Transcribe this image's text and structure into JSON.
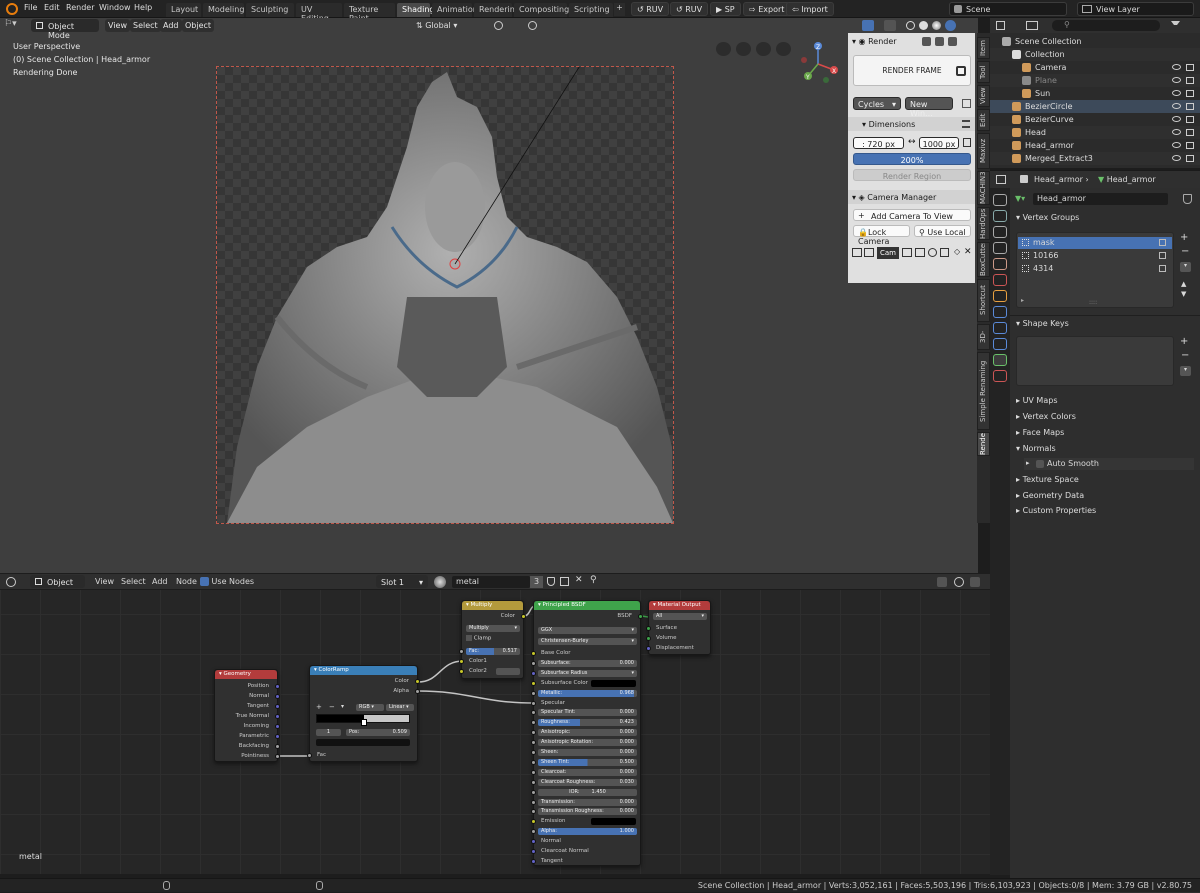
{
  "menu": [
    "File",
    "Edit",
    "Render",
    "Window",
    "Help"
  ],
  "workspaces": [
    "Layout",
    "Modeling",
    "Sculpting",
    "UV Editing",
    "Texture Paint",
    "Shading",
    "Animation",
    "Rendering",
    "Compositing",
    "Scripting"
  ],
  "active_workspace": "Shading",
  "top_buttons": [
    "RUV",
    "RUV",
    "SP",
    "Export",
    "Import"
  ],
  "scene": "Scene",
  "view_layer": "View Layer",
  "viewport": {
    "mode": "Object Mode",
    "menus": [
      "View",
      "Select",
      "Add",
      "Object"
    ],
    "transform": "Global",
    "info_lines": [
      "User Perspective",
      "(0) Scene Collection | Head_armor",
      "Rendering Done"
    ]
  },
  "npanel": {
    "render_title": "Render",
    "render_frame": "RENDER FRAME",
    "engine": "Cycles",
    "new_window": "New Win...",
    "dimensions_title": "Dimensions",
    "res_x": ": 720 px",
    "res_y": "1000 px",
    "percent": "200%",
    "render_region": "Render Region",
    "camera_manager": "Camera Manager",
    "add_camera": "Add Camera To View",
    "lock_camera": "Lock Camera",
    "use_local": "Use Local",
    "cam_tab": "Cam"
  },
  "vtabs": [
    "Item",
    "Tool",
    "View",
    "Edit",
    "Maxivz Tools",
    "MACHIN3",
    "HardOps",
    "BoxCutter",
    "Shortcut VUr",
    "3D-Coat",
    "Simple Renaming Panel",
    "Render"
  ],
  "outliner": {
    "rows": [
      "Scene Collection",
      "Collection",
      "Camera",
      "Plane",
      "Sun",
      "BezierCircle",
      "BezierCurve",
      "Head",
      "Head_armor",
      "Merged_Extract3"
    ]
  },
  "properties": {
    "breadcrumb_obj": "Head_armor",
    "breadcrumb_mesh": "Head_armor",
    "mesh_name": "Head_armor",
    "vertex_groups_title": "Vertex Groups",
    "vertex_groups": [
      "mask",
      "10166",
      "4314"
    ],
    "shape_keys_title": "Shape Keys",
    "sections": [
      "UV Maps",
      "Vertex Colors",
      "Face Maps",
      "Normals"
    ],
    "auto_smooth": "Auto Smooth",
    "sections2": [
      "Texture Space",
      "Geometry Data",
      "Custom Properties"
    ]
  },
  "node_editor": {
    "mode": "Object",
    "menus": [
      "View",
      "Select",
      "Add",
      "Node"
    ],
    "use_nodes": "Use Nodes",
    "slot": "Slot 1",
    "material": "metal",
    "users": "3",
    "footer_label": "metal",
    "geometry": {
      "title": "Geometry",
      "outputs": [
        "Position",
        "Normal",
        "Tangent",
        "True Normal",
        "Incoming",
        "Parametric",
        "Backfacing",
        "Pointiness"
      ]
    },
    "colorramp": {
      "title": "ColorRamp",
      "outputs": [
        "Color",
        "Alpha"
      ],
      "mode": "RGB",
      "interp": "Linear",
      "index": "1",
      "pos_label": "Pos:",
      "pos": "0.509",
      "input": "Fac"
    },
    "multiply": {
      "title": "Multiply",
      "output": "Color",
      "op": "Multiply",
      "clamp": "Clamp",
      "fac_label": "Fac:",
      "fac": "0.517",
      "inputs": [
        "Color1",
        "Color2"
      ]
    },
    "bsdf": {
      "title": "Principled BSDF",
      "output": "BSDF",
      "dist": "GGX",
      "sss": "Christensen-Burley",
      "rows": [
        {
          "l": "Base Color",
          "v": ""
        },
        {
          "l": "Subsurface:",
          "v": "0.000",
          "f": true
        },
        {
          "l": "Subsurface Radius",
          "v": "",
          "d": true
        },
        {
          "l": "Subsurface Color",
          "v": "",
          "c": true
        },
        {
          "l": "Metallic:",
          "v": "0.968",
          "f": true,
          "b": 0.968
        },
        {
          "l": "Specular",
          "v": ""
        },
        {
          "l": "Specular Tint:",
          "v": "0.000",
          "f": true
        },
        {
          "l": "Roughness:",
          "v": "0.423",
          "f": true,
          "b": 0.423
        },
        {
          "l": "Anisotropic:",
          "v": "0.000",
          "f": true
        },
        {
          "l": "Anisotropic Rotation:",
          "v": "0.000",
          "f": true
        },
        {
          "l": "Sheen:",
          "v": "0.000",
          "f": true
        },
        {
          "l": "Sheen Tint:",
          "v": "0.500",
          "f": true,
          "b": 0.5
        },
        {
          "l": "Clearcoat:",
          "v": "0.000",
          "f": true
        },
        {
          "l": "Clearcoat Roughness:",
          "v": "0.030",
          "f": true
        },
        {
          "l": "IOR:",
          "v": "1.450",
          "f": true,
          "ior": true
        },
        {
          "l": "Transmission:",
          "v": "0.000",
          "f": true
        },
        {
          "l": "Transmission Roughness:",
          "v": "0.000",
          "f": true
        },
        {
          "l": "Emission",
          "v": "",
          "c": true
        },
        {
          "l": "Alpha:",
          "v": "1.000",
          "f": true,
          "b": 1
        },
        {
          "l": "Normal",
          "v": ""
        },
        {
          "l": "Clearcoat Normal",
          "v": ""
        },
        {
          "l": "Tangent",
          "v": ""
        }
      ]
    },
    "output": {
      "title": "Material Output",
      "target": "All",
      "inputs": [
        "Surface",
        "Volume",
        "Displacement"
      ]
    }
  },
  "statusbar": "Scene Collection | Head_armor | Verts:3,052,161 | Faces:5,503,196 | Tris:6,103,923 | Objects:0/8 | Mem: 3.79 GB | v2.80.75",
  "colors": {
    "accent": "#4772b3",
    "header_geometry": "#b33c3c",
    "header_converter": "#3a7fb8",
    "header_color": "#b39a3c",
    "header_shader": "#3fa34b",
    "header_output": "#b33c3c"
  }
}
